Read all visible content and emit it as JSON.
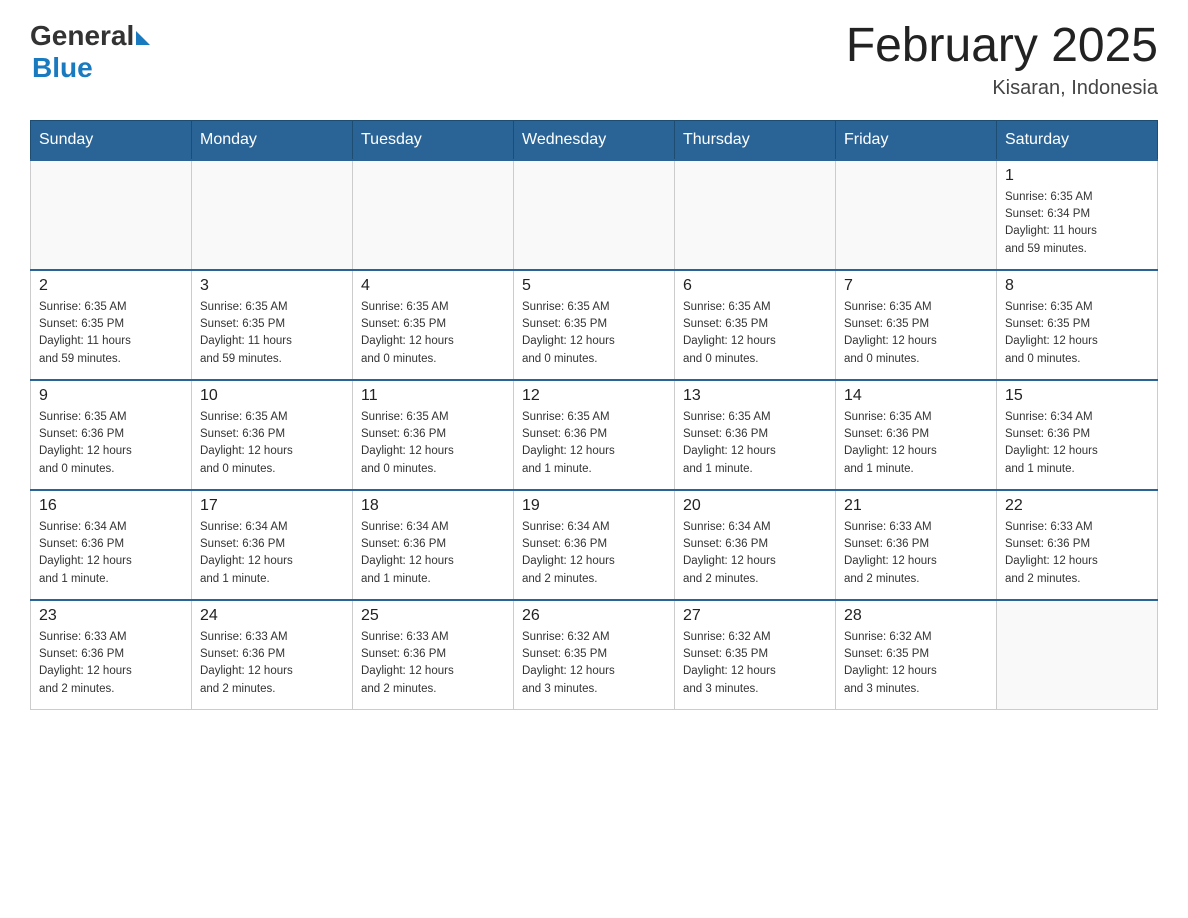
{
  "header": {
    "logo_general": "General",
    "logo_blue": "Blue",
    "title": "February 2025",
    "location": "Kisaran, Indonesia"
  },
  "days_of_week": [
    "Sunday",
    "Monday",
    "Tuesday",
    "Wednesday",
    "Thursday",
    "Friday",
    "Saturday"
  ],
  "weeks": [
    [
      {
        "day": "",
        "info": ""
      },
      {
        "day": "",
        "info": ""
      },
      {
        "day": "",
        "info": ""
      },
      {
        "day": "",
        "info": ""
      },
      {
        "day": "",
        "info": ""
      },
      {
        "day": "",
        "info": ""
      },
      {
        "day": "1",
        "info": "Sunrise: 6:35 AM\nSunset: 6:34 PM\nDaylight: 11 hours\nand 59 minutes."
      }
    ],
    [
      {
        "day": "2",
        "info": "Sunrise: 6:35 AM\nSunset: 6:35 PM\nDaylight: 11 hours\nand 59 minutes."
      },
      {
        "day": "3",
        "info": "Sunrise: 6:35 AM\nSunset: 6:35 PM\nDaylight: 11 hours\nand 59 minutes."
      },
      {
        "day": "4",
        "info": "Sunrise: 6:35 AM\nSunset: 6:35 PM\nDaylight: 12 hours\nand 0 minutes."
      },
      {
        "day": "5",
        "info": "Sunrise: 6:35 AM\nSunset: 6:35 PM\nDaylight: 12 hours\nand 0 minutes."
      },
      {
        "day": "6",
        "info": "Sunrise: 6:35 AM\nSunset: 6:35 PM\nDaylight: 12 hours\nand 0 minutes."
      },
      {
        "day": "7",
        "info": "Sunrise: 6:35 AM\nSunset: 6:35 PM\nDaylight: 12 hours\nand 0 minutes."
      },
      {
        "day": "8",
        "info": "Sunrise: 6:35 AM\nSunset: 6:35 PM\nDaylight: 12 hours\nand 0 minutes."
      }
    ],
    [
      {
        "day": "9",
        "info": "Sunrise: 6:35 AM\nSunset: 6:36 PM\nDaylight: 12 hours\nand 0 minutes."
      },
      {
        "day": "10",
        "info": "Sunrise: 6:35 AM\nSunset: 6:36 PM\nDaylight: 12 hours\nand 0 minutes."
      },
      {
        "day": "11",
        "info": "Sunrise: 6:35 AM\nSunset: 6:36 PM\nDaylight: 12 hours\nand 0 minutes."
      },
      {
        "day": "12",
        "info": "Sunrise: 6:35 AM\nSunset: 6:36 PM\nDaylight: 12 hours\nand 1 minute."
      },
      {
        "day": "13",
        "info": "Sunrise: 6:35 AM\nSunset: 6:36 PM\nDaylight: 12 hours\nand 1 minute."
      },
      {
        "day": "14",
        "info": "Sunrise: 6:35 AM\nSunset: 6:36 PM\nDaylight: 12 hours\nand 1 minute."
      },
      {
        "day": "15",
        "info": "Sunrise: 6:34 AM\nSunset: 6:36 PM\nDaylight: 12 hours\nand 1 minute."
      }
    ],
    [
      {
        "day": "16",
        "info": "Sunrise: 6:34 AM\nSunset: 6:36 PM\nDaylight: 12 hours\nand 1 minute."
      },
      {
        "day": "17",
        "info": "Sunrise: 6:34 AM\nSunset: 6:36 PM\nDaylight: 12 hours\nand 1 minute."
      },
      {
        "day": "18",
        "info": "Sunrise: 6:34 AM\nSunset: 6:36 PM\nDaylight: 12 hours\nand 1 minute."
      },
      {
        "day": "19",
        "info": "Sunrise: 6:34 AM\nSunset: 6:36 PM\nDaylight: 12 hours\nand 2 minutes."
      },
      {
        "day": "20",
        "info": "Sunrise: 6:34 AM\nSunset: 6:36 PM\nDaylight: 12 hours\nand 2 minutes."
      },
      {
        "day": "21",
        "info": "Sunrise: 6:33 AM\nSunset: 6:36 PM\nDaylight: 12 hours\nand 2 minutes."
      },
      {
        "day": "22",
        "info": "Sunrise: 6:33 AM\nSunset: 6:36 PM\nDaylight: 12 hours\nand 2 minutes."
      }
    ],
    [
      {
        "day": "23",
        "info": "Sunrise: 6:33 AM\nSunset: 6:36 PM\nDaylight: 12 hours\nand 2 minutes."
      },
      {
        "day": "24",
        "info": "Sunrise: 6:33 AM\nSunset: 6:36 PM\nDaylight: 12 hours\nand 2 minutes."
      },
      {
        "day": "25",
        "info": "Sunrise: 6:33 AM\nSunset: 6:36 PM\nDaylight: 12 hours\nand 2 minutes."
      },
      {
        "day": "26",
        "info": "Sunrise: 6:32 AM\nSunset: 6:35 PM\nDaylight: 12 hours\nand 3 minutes."
      },
      {
        "day": "27",
        "info": "Sunrise: 6:32 AM\nSunset: 6:35 PM\nDaylight: 12 hours\nand 3 minutes."
      },
      {
        "day": "28",
        "info": "Sunrise: 6:32 AM\nSunset: 6:35 PM\nDaylight: 12 hours\nand 3 minutes."
      },
      {
        "day": "",
        "info": ""
      }
    ]
  ]
}
